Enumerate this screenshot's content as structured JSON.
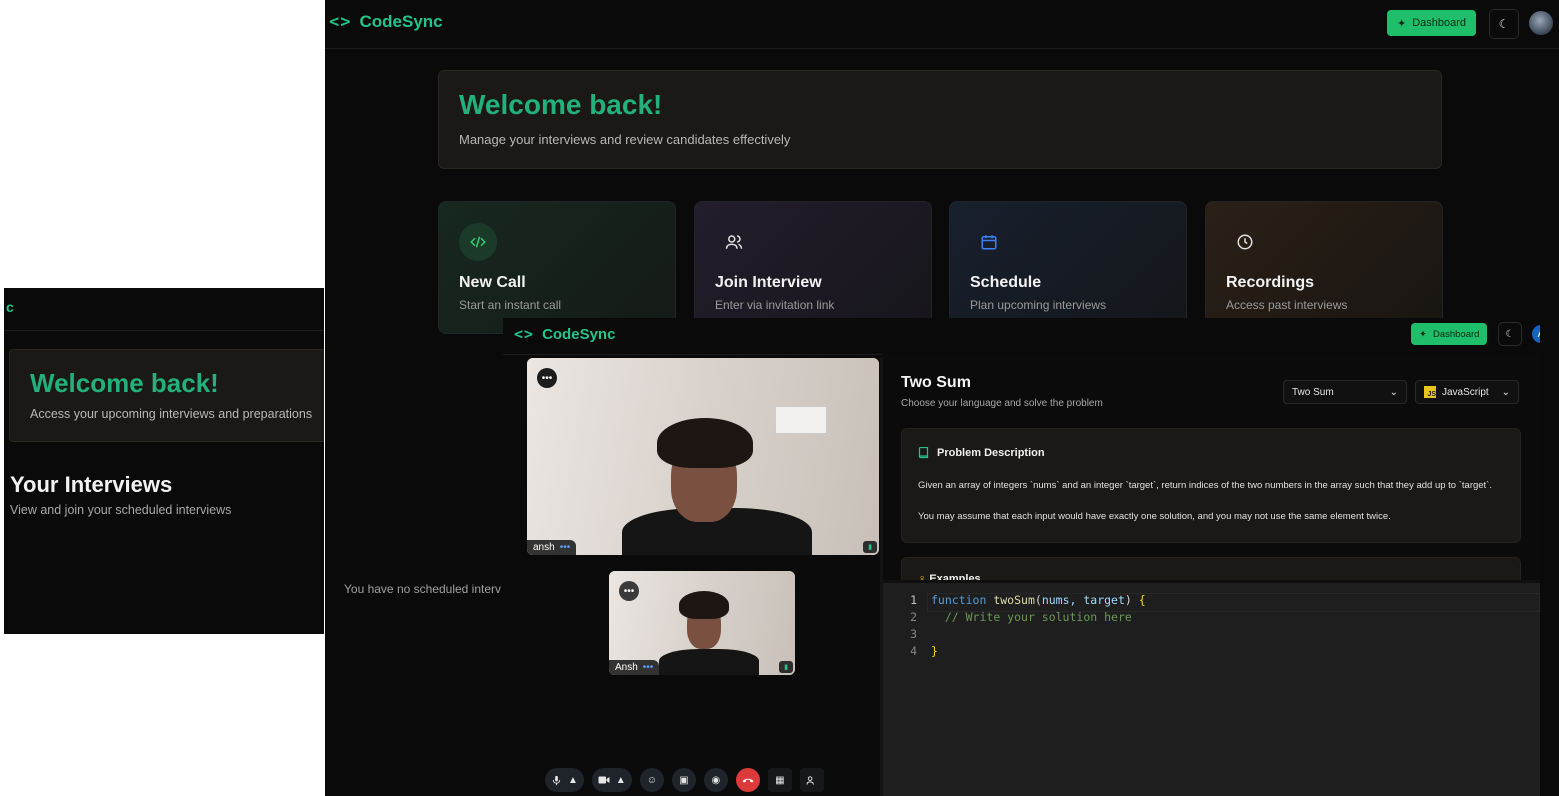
{
  "back_window": {
    "brand": {
      "icon": "code-brackets-icon",
      "name": "CodeSync"
    },
    "header": {
      "dashboard_label": "Dashboard",
      "theme_icon": "moon-icon"
    },
    "welcome": {
      "title": "Welcome back!",
      "subtitle": "Manage your interviews and review candidates effectively"
    },
    "actions": [
      {
        "icon": "code-icon",
        "title": "New Call",
        "subtitle": "Start an instant call"
      },
      {
        "icon": "users-icon",
        "title": "Join Interview",
        "subtitle": "Enter via invitation link"
      },
      {
        "icon": "calendar-icon",
        "title": "Schedule",
        "subtitle": "Plan upcoming interviews"
      },
      {
        "icon": "clock-icon",
        "title": "Recordings",
        "subtitle": "Access past interviews"
      }
    ],
    "empty_message": "You have no scheduled interv"
  },
  "left_window": {
    "brand_fragment": "c",
    "welcome": {
      "title": "Welcome back!",
      "subtitle": "Access your upcoming interviews and preparations"
    },
    "section": {
      "title": "Your Interviews",
      "subtitle": "View and join your scheduled interviews"
    }
  },
  "front_window": {
    "brand": {
      "icon": "code-brackets-icon",
      "name": "CodeSync"
    },
    "header": {
      "dashboard_label": "Dashboard",
      "avatar_initial": "A"
    },
    "videos": {
      "main": {
        "name": "ansh",
        "menu": "•••",
        "dots": "•••"
      },
      "self": {
        "name": "Ansh",
        "menu": "•••",
        "dots": "•••"
      }
    },
    "controls": [
      {
        "name": "mic-toggle",
        "icon": "microphone-icon"
      },
      {
        "name": "camera-toggle",
        "icon": "camera-icon"
      },
      {
        "name": "reactions",
        "icon": "smile-icon"
      },
      {
        "name": "screen-share",
        "icon": "screen-share-icon"
      },
      {
        "name": "record",
        "icon": "record-icon"
      },
      {
        "name": "end-call",
        "icon": "phone-end-icon"
      },
      {
        "name": "layout",
        "icon": "layout-icon"
      },
      {
        "name": "participants",
        "icon": "participants-icon"
      }
    ],
    "problem": {
      "title": "Two Sum",
      "subtitle": "Choose your language and solve the problem",
      "problem_select": "Two Sum",
      "language_select": "JavaScript",
      "language_badge": "JS",
      "description_heading": "Problem Description",
      "description_p1": "Given an array of integers `nums` and an integer `target`, return indices of the two numbers in the array such that they add up to `target`.",
      "description_p2": "You may assume that each input would have exactly one solution, and you may not use the same element twice.",
      "examples_heading": "Examples"
    },
    "editor": {
      "line_numbers": [
        "1",
        "2",
        "3",
        "4"
      ],
      "lines": [
        {
          "kw": "function",
          "fn": "twoSum",
          "p1": "(",
          "params": "nums, target",
          "p2": ")",
          "brace": "{"
        },
        {
          "comment": "// Write your solution here"
        },
        {},
        {
          "brace": "}"
        }
      ]
    }
  },
  "colors": {
    "accent": "#22c48a",
    "dashboard_button": "#1fbe6a",
    "end_call": "#dd3b3b",
    "avatar": "#1565c0"
  }
}
